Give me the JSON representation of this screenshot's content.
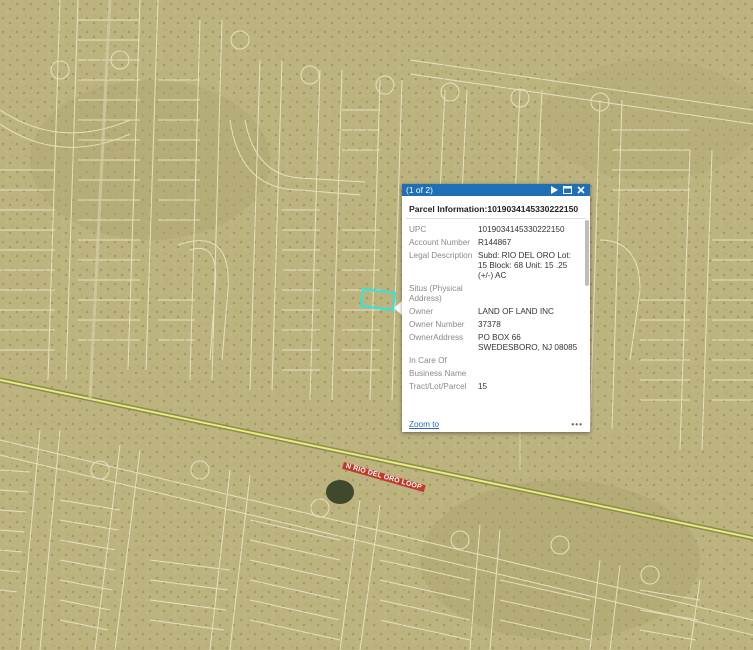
{
  "map": {
    "road_label": "N RIO DEL ORO LOOP",
    "colors": {
      "imagery": "#b9b07e",
      "parcel_lines": "#efe9c8",
      "road": "#e6ee7a",
      "selection": "#2ee6e0"
    }
  },
  "popup": {
    "counter": "(1 of 2)",
    "icons": [
      "next-icon",
      "maximize-icon",
      "close-icon"
    ],
    "title_label": "Parcel Information:",
    "title_value": "1019034145330222150",
    "fields": [
      {
        "label": "UPC",
        "value": "1019034145330222150"
      },
      {
        "label": "Account Number",
        "value": "R144867"
      },
      {
        "label": "Legal Description",
        "value": "Subd: RIO DEL ORO Lot: 15 Block: 68 Unit: 15 .25 (+/-) AC"
      },
      {
        "label": "Situs (Physical Address)",
        "value": ""
      },
      {
        "label": "Owner",
        "value": "LAND OF LAND INC"
      },
      {
        "label": "Owner Number",
        "value": "37378"
      },
      {
        "label": "OwnerAddress",
        "value": "PO BOX 66\nSWEDESBORO, NJ 08085"
      },
      {
        "label": "In Care Of",
        "value": ""
      },
      {
        "label": "Business Name",
        "value": ""
      },
      {
        "label": "Tract/Lot/Parcel",
        "value": "15"
      }
    ],
    "zoom_label": "Zoom to",
    "more_label": "•••"
  }
}
